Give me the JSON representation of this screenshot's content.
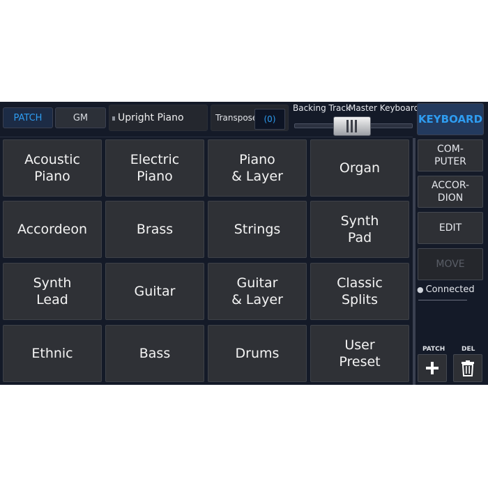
{
  "toolbar": {
    "patch_label": "PATCH",
    "gm_label": "GM",
    "patch_name": "Upright Piano",
    "transpose_label": "Transpose",
    "transpose_value": "(0)",
    "backing_track_label": "Backing Track",
    "master_keyboard_label": "Master Keyboard",
    "keyboard_button": "KEYBOARD"
  },
  "categories": [
    "Acoustic\nPiano",
    "Electric\nPiano",
    "Piano\n& Layer",
    "Organ",
    "Accordeon",
    "Brass",
    "Strings",
    "Synth\nPad",
    "Synth\nLead",
    "Guitar",
    "Guitar\n& Layer",
    "Classic\nSplits",
    "Ethnic",
    "Bass",
    "Drums",
    "User\nPreset"
  ],
  "side": {
    "computer": "COM-\nPUTER",
    "accordion": "ACCOR-\nDION",
    "edit": "EDIT",
    "move": "MOVE",
    "connected": "Connected",
    "patch_label": "PATCH",
    "del_label": "DEL"
  },
  "colors": {
    "accent": "#2e9cf0",
    "background": "#141a28",
    "tile": "#2f3136"
  },
  "icons": {
    "add": "plus-icon",
    "delete": "trash-icon",
    "status": "globe-icon"
  }
}
